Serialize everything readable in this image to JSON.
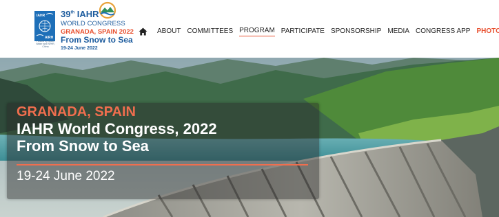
{
  "logo": {
    "edition": "39",
    "edition_suffix": "th",
    "org": "IAHR",
    "line2": "WORLD CONGRESS",
    "line3": "GRANADA, SPAIN 2022",
    "line4": "From Snow to Sea",
    "line5": "19-24 June 2022",
    "badge_top": "IAHR",
    "badge_bottom": "AIRH",
    "badge_note": "Hosted by Spain Water and IWHR, China",
    "emblem_icon": "mountain-sun-emblem-icon"
  },
  "nav": {
    "home_icon": "home-icon",
    "items": [
      {
        "label": "ABOUT"
      },
      {
        "label": "COMMITTEES"
      },
      {
        "label": "PROGRAM"
      },
      {
        "label": "PARTICIPATE"
      },
      {
        "label": "SPONSORSHIP"
      },
      {
        "label": "MEDIA"
      },
      {
        "label": "CONGRESS APP"
      },
      {
        "label": "PHOTOS"
      }
    ],
    "active": "PROGRAM",
    "search_icon": "search-icon"
  },
  "hero": {
    "city": "GRANADA, SPAIN",
    "title": "IAHR World Congress, 2022",
    "theme": "From Snow to Sea",
    "dates": "19-24 June 2022"
  },
  "colors": {
    "accent": "#e8502f",
    "brand_blue": "#1d5c9e"
  }
}
